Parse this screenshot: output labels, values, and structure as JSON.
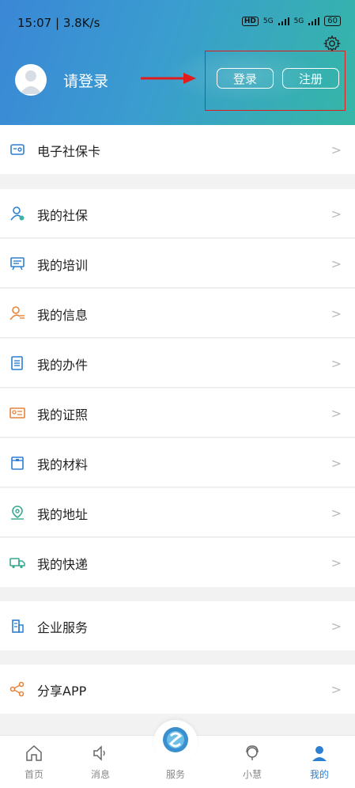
{
  "status": {
    "time_speed": "15:07 | 3.8K/s",
    "network": "5G",
    "battery": "60"
  },
  "header": {
    "login_prompt": "请登录",
    "login_button": "登录",
    "register_button": "注册"
  },
  "menu": [
    {
      "label": "电子社保卡",
      "icon": "social-card-icon"
    },
    {
      "label": "我的社保",
      "icon": "person-badge-icon"
    },
    {
      "label": "我的培训",
      "icon": "training-icon"
    },
    {
      "label": "我的信息",
      "icon": "person-info-icon"
    },
    {
      "label": "我的办件",
      "icon": "document-icon"
    },
    {
      "label": "我的证照",
      "icon": "certificate-icon"
    },
    {
      "label": "我的材料",
      "icon": "folder-icon"
    },
    {
      "label": "我的地址",
      "icon": "location-icon"
    },
    {
      "label": "我的快递",
      "icon": "delivery-truck-icon"
    },
    {
      "label": "企业服务",
      "icon": "building-icon"
    },
    {
      "label": "分享APP",
      "icon": "share-icon"
    }
  ],
  "tabs": [
    {
      "label": "首页",
      "icon": "home-icon"
    },
    {
      "label": "消息",
      "icon": "speaker-icon"
    },
    {
      "label": "服务",
      "icon": "service-logo-icon"
    },
    {
      "label": "小慧",
      "icon": "assistant-icon"
    },
    {
      "label": "我的",
      "icon": "user-icon"
    }
  ],
  "colors": {
    "accent": "#2c7fd1",
    "header_start": "#3a87d6",
    "header_end": "#35b7a6",
    "highlight": "#e01c1c"
  }
}
